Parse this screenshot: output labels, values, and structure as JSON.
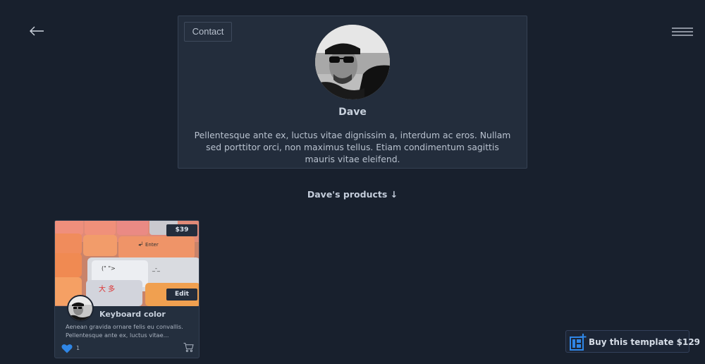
{
  "nav": {
    "back_icon": "arrow-left-icon",
    "menu_icon": "hamburger-menu-icon"
  },
  "profile": {
    "contact_label": "Contact",
    "name": "Dave",
    "bio": "Pellentesque ante ex, luctus vitae dignissim a, interdum ac eros. Nullam sed porttitor orci, non maximus tellus. Etiam condimentum sagittis mauris vitae eleifend."
  },
  "products": {
    "heading": "Dave's products ↓",
    "items": [
      {
        "price": "$39",
        "edit_label": "Edit",
        "title": "Keyboard color",
        "description": "Aenean gravida ornare felis eu convallis. Pellentesque ante ex, luctus vitae...",
        "likes": "1"
      }
    ]
  },
  "footer": {
    "buy_label": "Buy this template $129"
  },
  "colors": {
    "background": "#18202d",
    "card": "#232d3c",
    "like": "#2f86e6",
    "accent": "#2f86e6"
  }
}
